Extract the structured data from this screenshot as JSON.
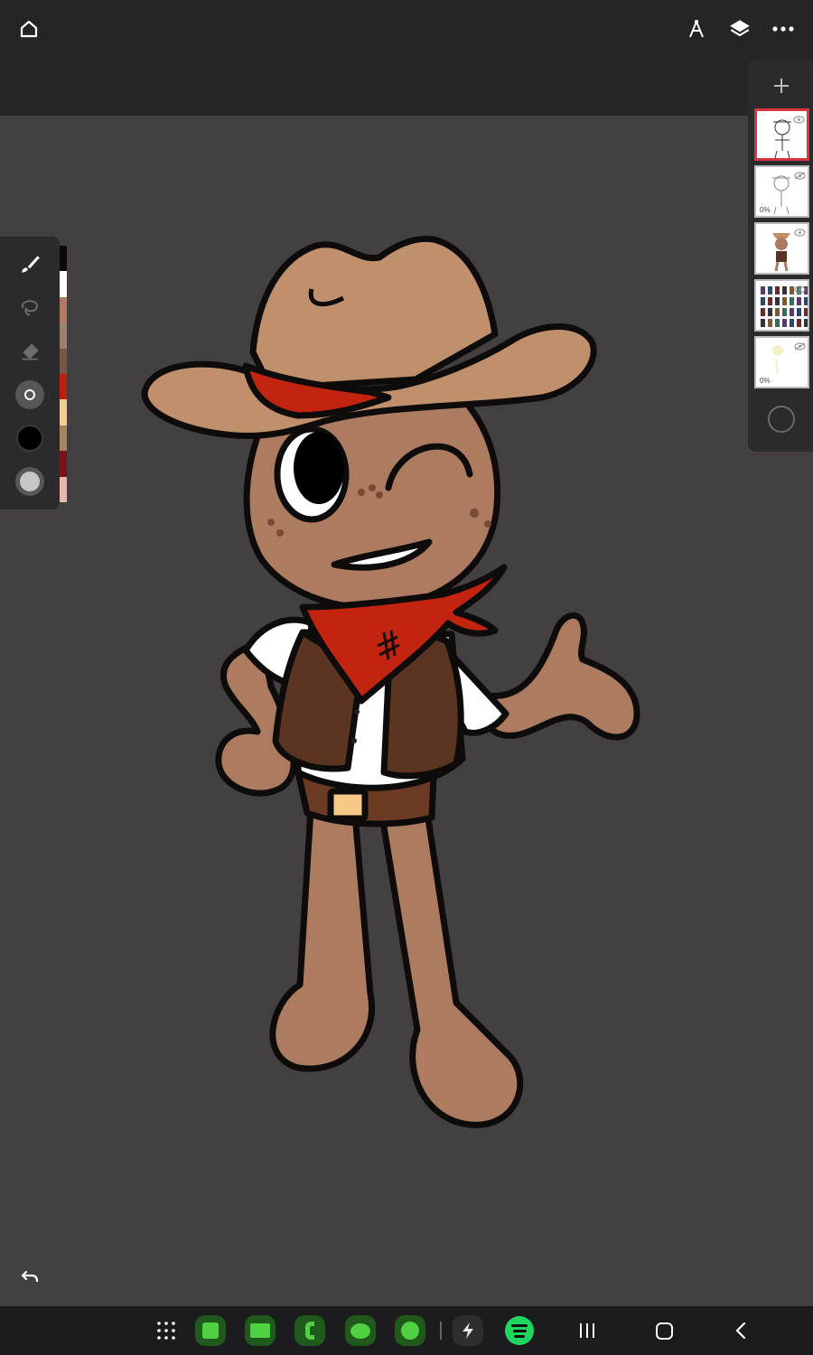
{
  "topbar": {
    "home_icon": "home-icon",
    "ruler_icon": "ruler-icon",
    "layers_icon": "layers-icon",
    "more_icon": "more-icon"
  },
  "tools": [
    "brush-icon",
    "lasso-icon",
    "eraser-icon",
    "brush-size-icon",
    "color-icon",
    "opacity-icon"
  ],
  "palette": [
    "#0a0a0a",
    "#ffffff",
    "#b27a5e",
    "#9e8070",
    "#7b5545",
    "#c01e10",
    "#f5cf8e",
    "#a88560",
    "#7b0f1c",
    "#e8b7b3"
  ],
  "colors": {
    "accent": "#d9353f",
    "canvas_bg": "#444042",
    "skin": "#ad7b60",
    "hat": "#c08f6c",
    "bandana": "#c32410",
    "vest": "#5c3522"
  },
  "layers": [
    {
      "name": "sketch-lines",
      "opacity_label": "",
      "active": true,
      "visible": true
    },
    {
      "name": "sketch-rough",
      "opacity_label": "0%",
      "active": false,
      "visible": false
    },
    {
      "name": "color-art",
      "opacity_label": "",
      "active": false,
      "visible": true
    },
    {
      "name": "reference-sheet",
      "opacity_label": "",
      "active": false,
      "visible": true
    },
    {
      "name": "light-layer",
      "opacity_label": "0%",
      "active": false,
      "visible": false
    }
  ],
  "navbar": {
    "apps": [
      "app-drawer-icon",
      "notes-app-icon",
      "files-app-icon",
      "phone-app-icon",
      "messages-app-icon",
      "sketch-app-icon",
      "power-app-icon",
      "spotify-app-icon"
    ],
    "recents_icon": "recents-icon",
    "home_icon": "home-circle-icon",
    "back_icon": "back-icon"
  }
}
